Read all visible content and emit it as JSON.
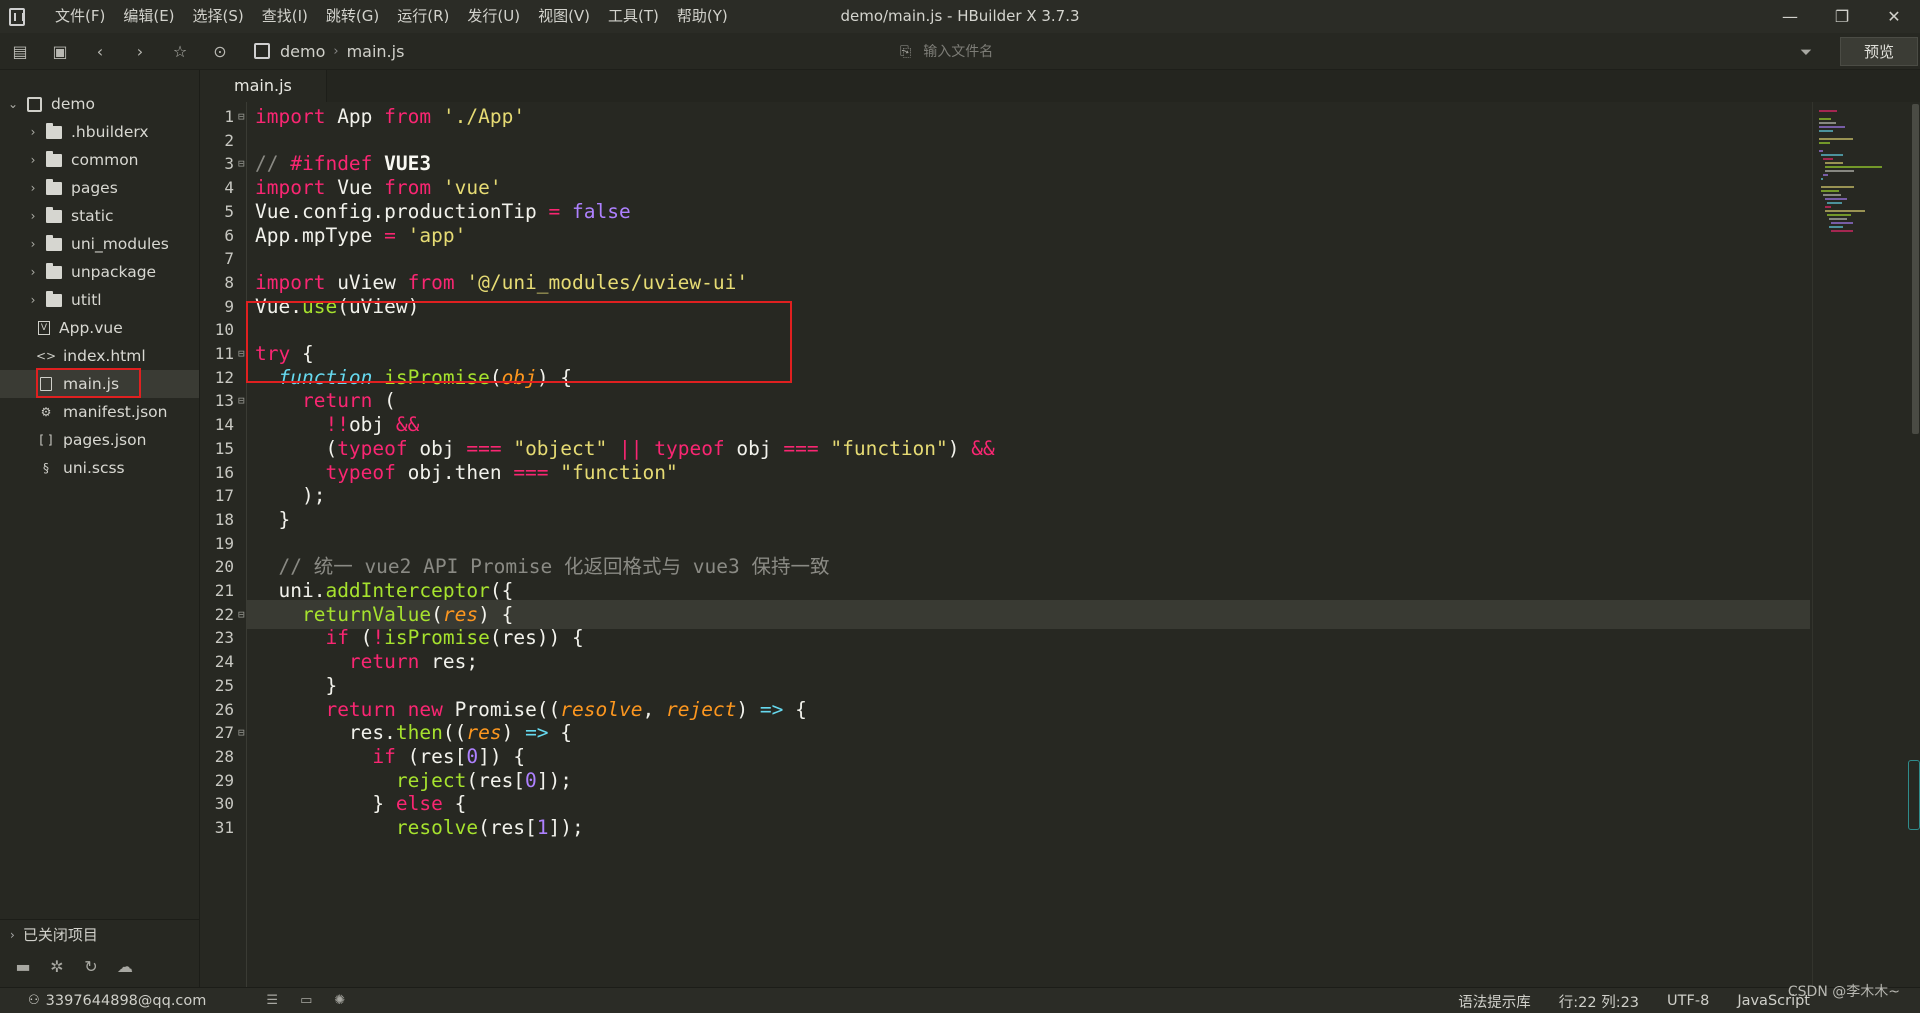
{
  "window": {
    "title": "demo/main.js - HBuilder X 3.7.3",
    "minimize": "—",
    "maximize": "❐",
    "close": "✕"
  },
  "menu": [
    "文件(F)",
    "编辑(E)",
    "选择(S)",
    "查找(I)",
    "跳转(G)",
    "运行(R)",
    "发行(U)",
    "视图(V)",
    "工具(T)",
    "帮助(Y)"
  ],
  "toolbar": {
    "breadcrumb": [
      "demo",
      "main.js"
    ],
    "file_search_placeholder": "输入文件名",
    "preview_label": "预览"
  },
  "sidebar": {
    "project": "demo",
    "items": [
      {
        "label": ".hbuilderx",
        "type": "folder"
      },
      {
        "label": "common",
        "type": "folder"
      },
      {
        "label": "pages",
        "type": "folder"
      },
      {
        "label": "static",
        "type": "folder"
      },
      {
        "label": "uni_modules",
        "type": "folder"
      },
      {
        "label": "unpackage",
        "type": "folder"
      },
      {
        "label": "utitl",
        "type": "folder"
      },
      {
        "label": "App.vue",
        "type": "vue"
      },
      {
        "label": "index.html",
        "type": "html"
      },
      {
        "label": "main.js",
        "type": "js",
        "selected": true
      },
      {
        "label": "manifest.json",
        "type": "manifest"
      },
      {
        "label": "pages.json",
        "type": "json"
      },
      {
        "label": "uni.scss",
        "type": "scss"
      }
    ],
    "closed_projects": "已关闭项目"
  },
  "editor": {
    "tab": "main.js",
    "current_line": 22,
    "lines": [
      {
        "n": "1",
        "fold": true,
        "html": "<span class='k'>import</span> App <span class='k'>from</span> <span class='s'>'./App'</span>"
      },
      {
        "n": "2",
        "html": ""
      },
      {
        "n": "3",
        "fold": true,
        "html": "<span class='c'>// </span><span class='k'>#ifndef</span> <span class='w bold'>VUE3</span>"
      },
      {
        "n": "4",
        "html": "<span class='k'>import</span> Vue <span class='k'>from</span> <span class='s'>'vue'</span>"
      },
      {
        "n": "5",
        "html": "Vue.config.productionTip <span class='k'>=</span> <span class='b'>false</span>"
      },
      {
        "n": "6",
        "html": "App.mpType <span class='k'>=</span> <span class='s'>'app'</span>"
      },
      {
        "n": "7",
        "html": ""
      },
      {
        "n": "8",
        "html": "<span class='k'>import</span> uView <span class='k'>from</span> <span class='s'>'@/uni_modules/uview-ui'</span>"
      },
      {
        "n": "9",
        "html": "Vue.<span class='f'>use</span>(uView)"
      },
      {
        "n": "10",
        "html": ""
      },
      {
        "n": "11",
        "fold": true,
        "html": "<span class='k'>try</span> {"
      },
      {
        "n": "12",
        "html": "  <span class='t'>function</span> <span class='f'>isPromise</span>(<span class='p'>obj</span>) {"
      },
      {
        "n": "13",
        "fold": true,
        "html": "    <span class='k'>return</span> ("
      },
      {
        "n": "14",
        "html": "      <span class='k'>!!</span>obj <span class='k'>&amp;&amp;</span>"
      },
      {
        "n": "15",
        "html": "      (<span class='k'>typeof</span> obj <span class='k'>===</span> <span class='s'>\"object\"</span> <span class='k'>||</span> <span class='k'>typeof</span> obj <span class='k'>===</span> <span class='s'>\"function\"</span>) <span class='k'>&amp;&amp;</span>"
      },
      {
        "n": "16",
        "html": "      <span class='k'>typeof</span> obj.then <span class='k'>===</span> <span class='s'>\"function\"</span>"
      },
      {
        "n": "17",
        "html": "    );"
      },
      {
        "n": "18",
        "html": "  }"
      },
      {
        "n": "19",
        "html": ""
      },
      {
        "n": "20",
        "html": "  <span class='c'>// 统一 vue2 API Promise 化返回格式与 vue3 保持一致</span>"
      },
      {
        "n": "21",
        "html": "  uni.<span class='f'>addInterceptor</span>({"
      },
      {
        "n": "22",
        "fold": true,
        "html": "    <span class='f'>returnValue</span>(<span class='p'>res</span>) {"
      },
      {
        "n": "23",
        "html": "      <span class='k'>if</span> (<span class='k'>!</span><span class='f'>isPromise</span>(res)) {"
      },
      {
        "n": "24",
        "html": "        <span class='k'>return</span> res;"
      },
      {
        "n": "25",
        "html": "      }"
      },
      {
        "n": "26",
        "html": "      <span class='k'>return</span> <span class='k'>new</span> Promise((<span class='p'>resolve</span>, <span class='p'>reject</span>) <span class='t'>=&gt;</span> {"
      },
      {
        "n": "27",
        "fold": true,
        "html": "        res.<span class='f'>then</span>((<span class='p'>res</span>) <span class='t'>=&gt;</span> {"
      },
      {
        "n": "28",
        "html": "          <span class='k'>if</span> (res[<span class='b'>0</span>]) {"
      },
      {
        "n": "29",
        "html": "            <span class='f'>reject</span>(res[<span class='b'>0</span>]);"
      },
      {
        "n": "30",
        "html": "          } <span class='k'>else</span> {"
      },
      {
        "n": "31",
        "html": "            <span class='f'>resolve</span>(res[<span class='b'>1</span>]);"
      }
    ]
  },
  "statusbar": {
    "user": "3397644898@qq.com",
    "hint_lib": "语法提示库",
    "position": "行:22  列:23",
    "encoding": "UTF-8",
    "language": "JavaScript"
  },
  "watermark": "CSDN @李木木~",
  "colors": {
    "background": "#272822",
    "keyword": "#f92672",
    "string": "#e6db74",
    "function": "#a6e22e",
    "number": "#ae81ff",
    "param": "#fd971f",
    "highlight_box": "#e02020"
  }
}
